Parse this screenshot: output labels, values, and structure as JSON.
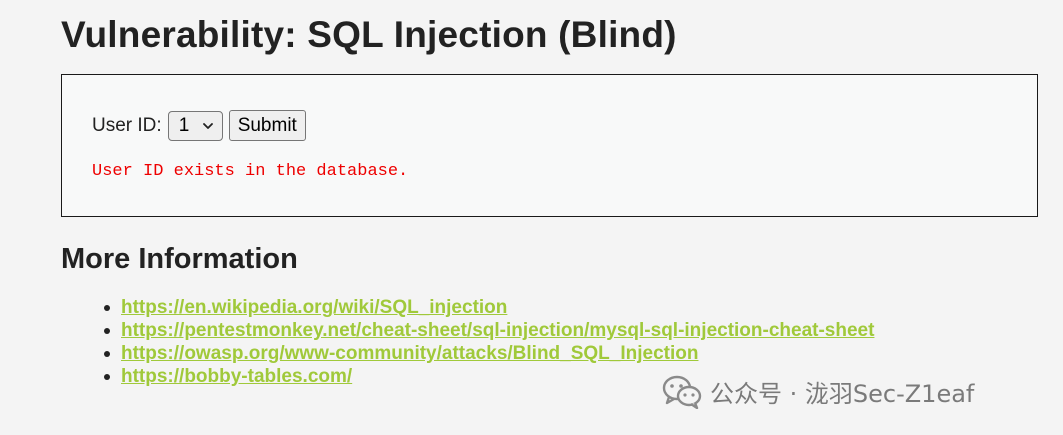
{
  "page": {
    "title": "Vulnerability: SQL Injection (Blind)"
  },
  "form": {
    "user_id_label": "User ID:",
    "selected_user_id": "1",
    "submit_label": "Submit",
    "result_message": "User ID exists in the database."
  },
  "more_info": {
    "heading": "More Information",
    "links": [
      "https://en.wikipedia.org/wiki/SQL_injection",
      "https://pentestmonkey.net/cheat-sheet/sql-injection/mysql-sql-injection-cheat-sheet",
      "https://owasp.org/www-community/attacks/Blind_SQL_Injection",
      "https://bobby-tables.com/"
    ]
  },
  "watermark": {
    "text": "公众号 · 泷羽Sec-Z1eaf",
    "icon": "wechat-icon"
  },
  "colors": {
    "link": "#a0c93a",
    "error_text": "#ee0000"
  }
}
